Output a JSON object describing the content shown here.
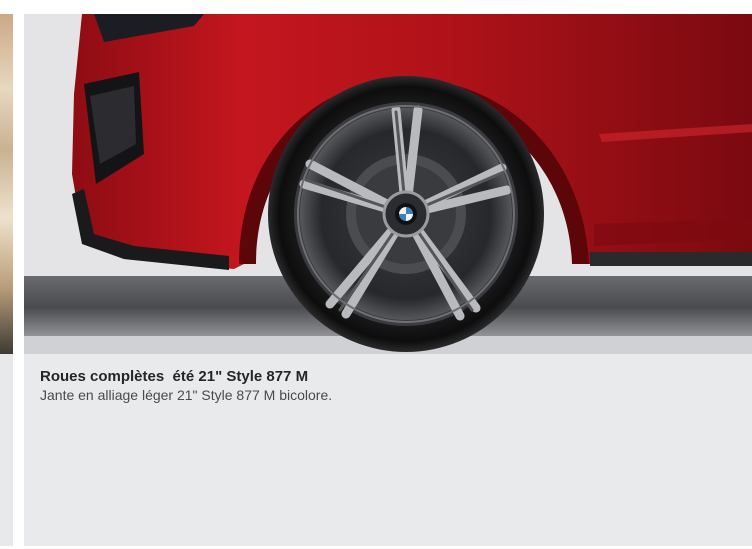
{
  "carousel": {
    "items": [
      {
        "title": "Roues complètes  été 21\" Style 877 M",
        "description": "Jante en alliage léger 21\" Style 877 M bicolore.",
        "image_icon": "alloy-wheel-photo"
      }
    ]
  },
  "colors": {
    "card_background": "#e9eaeb",
    "car_body": "#b3121b",
    "title_text": "#262626",
    "description_text": "#4a4a4a"
  }
}
